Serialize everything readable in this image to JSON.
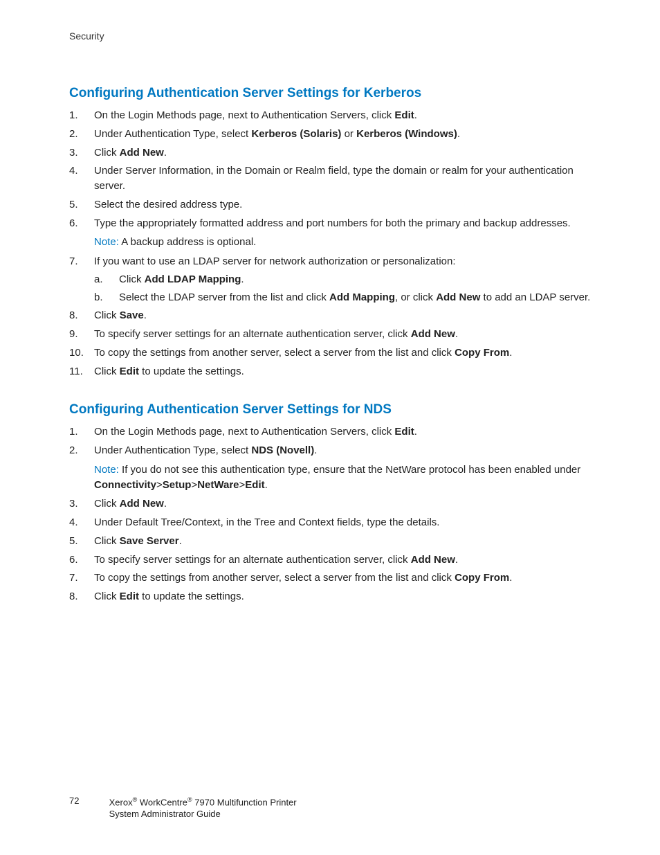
{
  "header": {
    "section_label": "Security"
  },
  "sections": [
    {
      "title": "Configuring Authentication Server Settings for Kerberos",
      "items": [
        {
          "pre": "On the Login Methods page, next to Authentication Servers, click ",
          "b1": "Edit",
          "post": "."
        },
        {
          "pre": "Under Authentication Type, select ",
          "b1": "Kerberos (Solaris)",
          "mid": " or ",
          "b2": "Kerberos (Windows)",
          "post": "."
        },
        {
          "pre": "Click ",
          "b1": "Add New",
          "post": "."
        },
        {
          "pre": "Under Server Information, in the Domain or Realm field, type the domain or realm for your authentication server."
        },
        {
          "pre": "Select the desired address type."
        },
        {
          "pre": "Type the appropriately formatted address and port numbers for both the primary and backup addresses.",
          "note": {
            "label": "Note:",
            "text": " A backup address is optional."
          }
        },
        {
          "pre": "If you want to use an LDAP server for network authorization or personalization:",
          "sub": [
            {
              "pre": "Click ",
              "b1": "Add LDAP Mapping",
              "post": "."
            },
            {
              "pre": "Select the LDAP server from the list and click ",
              "b1": "Add Mapping",
              "mid": ", or click ",
              "b2": "Add New",
              "post": " to add an LDAP server."
            }
          ]
        },
        {
          "pre": "Click ",
          "b1": "Save",
          "post": "."
        },
        {
          "pre": "To specify server settings for an alternate authentication server, click ",
          "b1": "Add New",
          "post": "."
        },
        {
          "pre": "To copy the settings from another server, select a server from the list and click ",
          "b1": "Copy From",
          "post": "."
        },
        {
          "pre": "Click ",
          "b1": "Edit",
          "post": " to update the settings."
        }
      ]
    },
    {
      "title": "Configuring Authentication Server Settings for NDS",
      "items": [
        {
          "pre": "On the Login Methods page, next to Authentication Servers, click ",
          "b1": "Edit",
          "post": "."
        },
        {
          "pre": "Under Authentication Type, select ",
          "b1": "NDS (Novell)",
          "post": ".",
          "note": {
            "label": "Note:",
            "text": " If you do not see this authentication type, ensure that the NetWare protocol has been enabled under ",
            "b1": "Connectivity",
            "s1": ">",
            "b2": "Setup",
            "s2": ">",
            "b3": "NetWare",
            "s3": ">",
            "b4": "Edit",
            "post": "."
          }
        },
        {
          "pre": "Click ",
          "b1": "Add New",
          "post": "."
        },
        {
          "pre": "Under Default Tree/Context, in the Tree and Context fields, type the details."
        },
        {
          "pre": "Click ",
          "b1": "Save Server",
          "post": "."
        },
        {
          "pre": "To specify server settings for an alternate authentication server, click ",
          "b1": "Add New",
          "post": "."
        },
        {
          "pre": "To copy the settings from another server, select a server from the list and click ",
          "b1": "Copy From",
          "post": "."
        },
        {
          "pre": "Click ",
          "b1": "Edit",
          "post": " to update the settings."
        }
      ]
    }
  ],
  "footer": {
    "page": "72",
    "line1_a": "Xerox",
    "line1_b": " WorkCentre",
    "line1_c": " 7970 Multifunction Printer",
    "line2": "System Administrator Guide"
  }
}
